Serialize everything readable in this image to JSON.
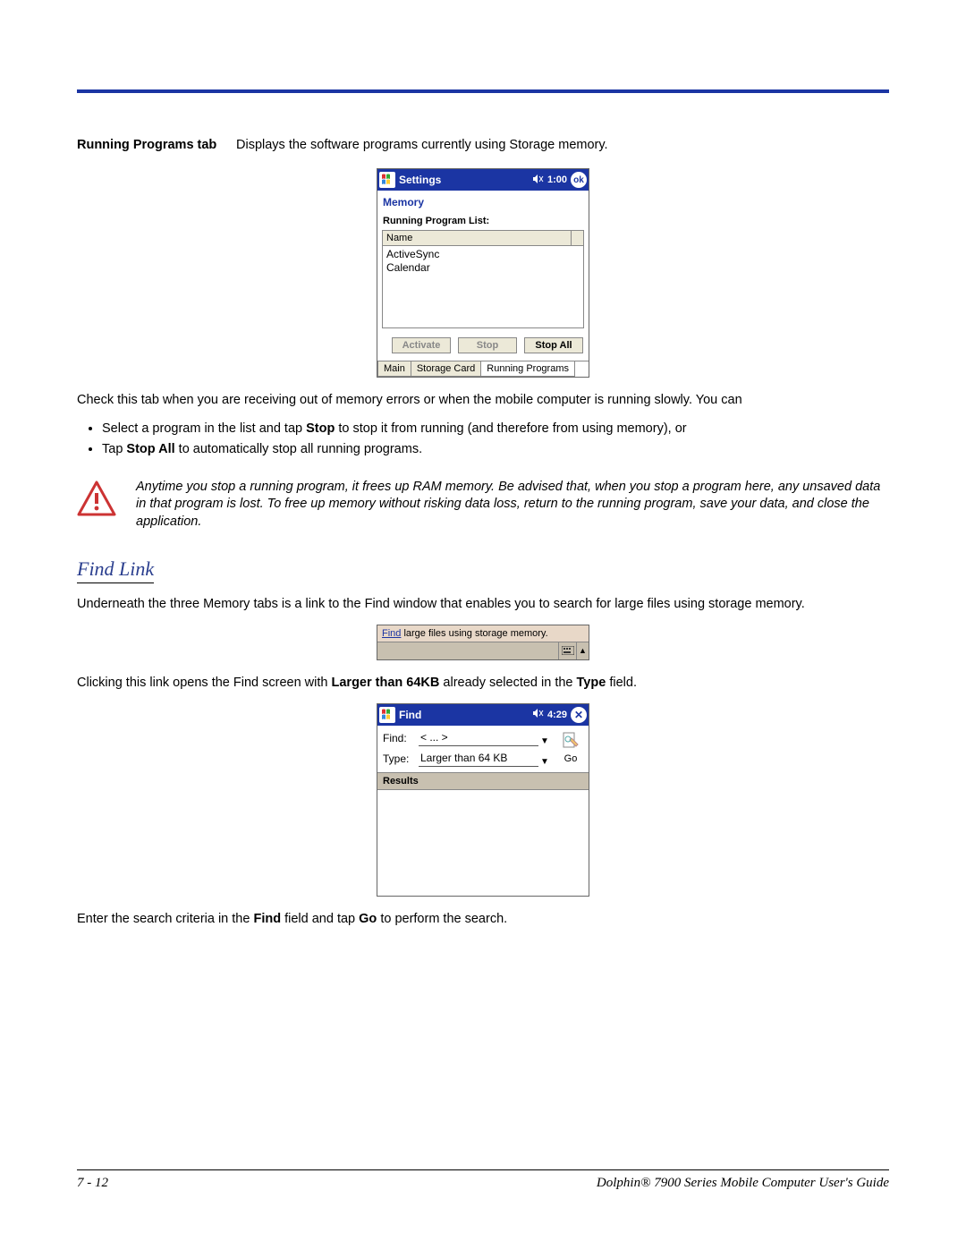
{
  "header": {
    "row_label": "Running Programs tab",
    "row_text": "Displays the software programs currently using Storage memory."
  },
  "screenshot1": {
    "titlebar": {
      "title": "Settings",
      "time": "1:00",
      "ok": "ok"
    },
    "applet_title": "Memory",
    "running_label": "Running Program List:",
    "name_column": "Name",
    "items": [
      "ActiveSync",
      "Calendar"
    ],
    "buttons": {
      "activate": "Activate",
      "stop": "Stop",
      "stop_all": "Stop All"
    },
    "tabs": [
      "Main",
      "Storage Card",
      "Running Programs"
    ]
  },
  "para_check": "Check this tab when you are receiving out of memory errors or when the mobile computer is running slowly. You can",
  "bullets": {
    "b1_pre": "Select a program in the list and tap ",
    "b1_bold": "Stop",
    "b1_post": " to stop it from running (and therefore from using memory), or",
    "b2_pre": "Tap ",
    "b2_bold": "Stop All",
    "b2_post": " to automatically stop all running programs."
  },
  "warning": "Anytime you stop a running program, it frees up RAM memory. Be advised that, when you stop a program here, any unsaved data in that program is lost. To free up memory without risking data loss, return to the running program, save your data, and close the application.",
  "heading_findlink": "Find Link",
  "para_findlink_intro": "Underneath the three Memory tabs is a link to the Find window that enables you to search for large files using storage memory.",
  "findbar": {
    "link": "Find",
    "text": " large files using storage memory."
  },
  "para_click_pre": "Clicking this link opens the Find screen with ",
  "para_click_bold1": "Larger than 64KB",
  "para_click_mid": " already selected in the ",
  "para_click_bold2": "Type",
  "para_click_post": " field.",
  "screenshot2": {
    "titlebar": {
      "title": "Find",
      "time": "4:29"
    },
    "form": {
      "find_label": "Find:",
      "find_value": "< ... >",
      "type_label": "Type:",
      "type_value": "Larger than 64 KB",
      "go_label": "Go"
    },
    "results_label": "Results"
  },
  "para_enter_pre": "Enter the search criteria in the ",
  "para_enter_bold1": "Find",
  "para_enter_mid": " field and tap ",
  "para_enter_bold2": "Go",
  "para_enter_post": " to perform the search.",
  "footer": {
    "page": "7 - 12",
    "title": "Dolphin® 7900 Series Mobile Computer User's Guide"
  }
}
